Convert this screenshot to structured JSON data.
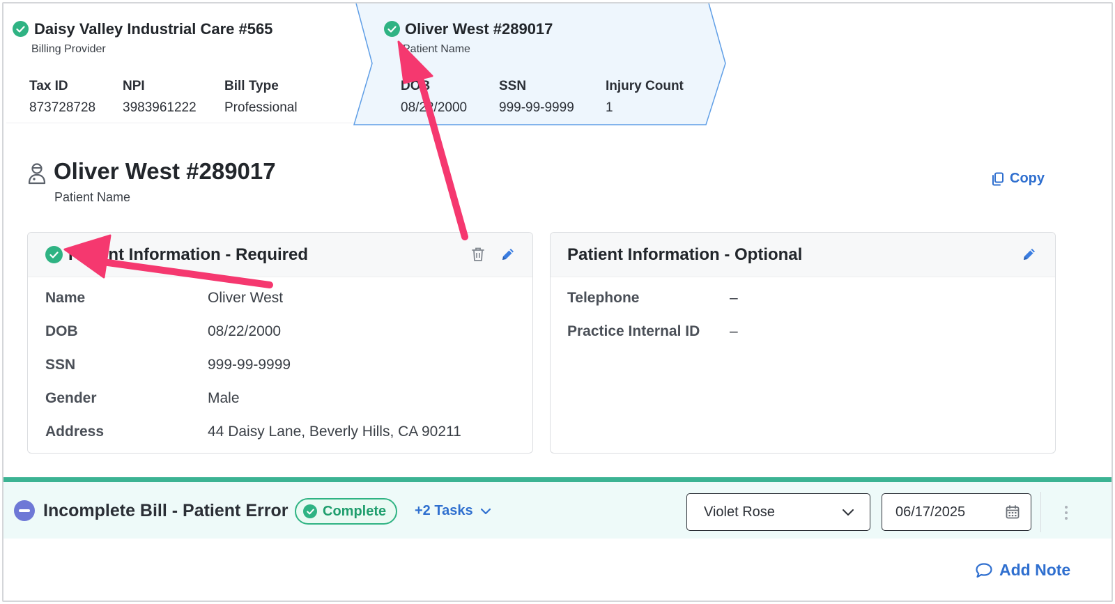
{
  "steps": [
    {
      "title": "Daisy Valley Industrial Care #565",
      "subtitle": "Billing Provider",
      "fields": [
        {
          "label": "Tax ID",
          "value": "873728728"
        },
        {
          "label": "NPI",
          "value": "3983961222"
        },
        {
          "label": "Bill Type",
          "value": "Professional"
        }
      ]
    },
    {
      "title": "Oliver West #289017",
      "subtitle": "Patient Name",
      "fields": [
        {
          "label": "DOB",
          "value": "08/22/2000"
        },
        {
          "label": "SSN",
          "value": "999-99-9999"
        },
        {
          "label": "Injury Count",
          "value": "1"
        }
      ]
    }
  ],
  "patient": {
    "title": "Oliver West #289017",
    "subtitle": "Patient Name",
    "copy_label": "Copy"
  },
  "required_panel": {
    "title": "Patient Information - Required",
    "rows": [
      {
        "label": "Name",
        "value": "Oliver West"
      },
      {
        "label": "DOB",
        "value": "08/22/2000"
      },
      {
        "label": "SSN",
        "value": "999-99-9999"
      },
      {
        "label": "Gender",
        "value": "Male"
      },
      {
        "label": "Address",
        "value": "44 Daisy Lane, Beverly Hills, CA 90211"
      }
    ]
  },
  "optional_panel": {
    "title": "Patient Information - Optional",
    "rows": [
      {
        "label": "Telephone",
        "value": "–"
      },
      {
        "label": "Practice Internal ID",
        "value": "–"
      }
    ]
  },
  "bill": {
    "title": "Incomplete Bill - Patient Error",
    "status": "Complete",
    "tasks_label": "+2 Tasks",
    "assignee": "Violet Rose",
    "date": "06/17/2025"
  },
  "add_note_label": "Add Note",
  "colors": {
    "success": "#2fb383",
    "link": "#2f6fcf",
    "accent_bar": "#3bb393",
    "arrow": "#f5386f",
    "incomplete": "#6e78d6"
  }
}
